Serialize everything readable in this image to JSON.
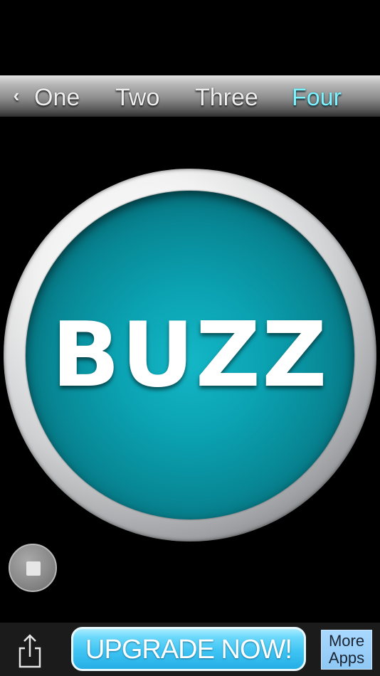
{
  "tabbar": {
    "back_glyph": "‹",
    "tabs": [
      {
        "label": "One",
        "selected": false
      },
      {
        "label": "Two",
        "selected": false
      },
      {
        "label": "Three",
        "selected": false
      },
      {
        "label": "Four",
        "selected": true
      }
    ],
    "selected_color": "#7ff4ff"
  },
  "buzzer": {
    "label": "BUZZ",
    "color": "#0ba3b3"
  },
  "controls": {
    "stop_icon": "stop-icon"
  },
  "bottombar": {
    "share_icon": "share-icon",
    "upgrade_label": "UPGRADE NOW!",
    "more_apps_line1": "More",
    "more_apps_line2": "Apps"
  }
}
